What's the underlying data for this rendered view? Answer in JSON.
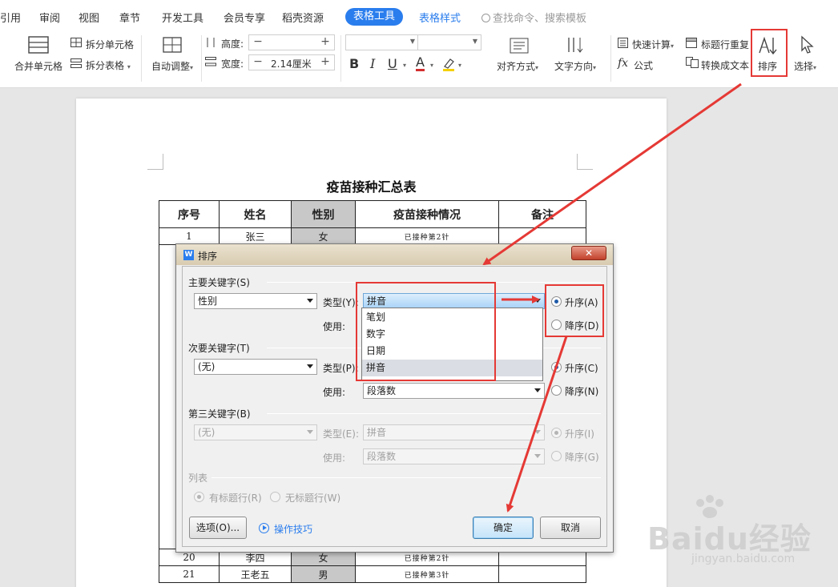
{
  "menubar": {
    "items": [
      "引用",
      "审阅",
      "视图",
      "章节",
      "开发工具",
      "会员专享",
      "稻壳资源"
    ],
    "active_tab": "表格工具",
    "style_tab": "表格样式",
    "search": "查找命令、搜索模板"
  },
  "ribbon": {
    "merge_cells": "合并单元格",
    "split_cells": "拆分单元格",
    "split_table": "拆分表格",
    "auto_adjust": "自动调整",
    "height_label": "高度:",
    "height_value": "",
    "width_label": "宽度:",
    "width_value": "2.14厘米",
    "font_name": "",
    "font_size": "",
    "bold": "B",
    "italic": "I",
    "underline": "U",
    "font_color": "A",
    "align": "对齐方式",
    "text_direction": "文字方向",
    "quick_calc": "快速计算",
    "header_repeat": "标题行重复",
    "formula": "公式",
    "convert_text": "转换成文本",
    "sort": "排序",
    "select": "选择"
  },
  "document": {
    "title": "疫苗接种汇总表",
    "headers": [
      "序号",
      "姓名",
      "性别",
      "疫苗接种情况",
      "备注"
    ],
    "rows": [
      {
        "no": "1",
        "name": "张三",
        "gender": "女",
        "status": "已接种第2针",
        "note": ""
      },
      {
        "no": "20",
        "name": "李四",
        "gender": "女",
        "status": "已接种第2针",
        "note": ""
      },
      {
        "no": "21",
        "name": "王老五",
        "gender": "男",
        "status": "已接种第3针",
        "note": ""
      }
    ]
  },
  "dialog": {
    "title": "排序",
    "close": "✕",
    "primary_key_label": "主要关键字(S)",
    "primary_key_value": "性别",
    "type_y_label": "类型(Y):",
    "type_y_value": "拼音",
    "use_label_1": "使用:",
    "asc_a": "升序(A)",
    "desc_d": "降序(D)",
    "type_options": [
      "笔划",
      "数字",
      "日期",
      "拼音"
    ],
    "secondary_key_label": "次要关键字(T)",
    "secondary_key_value": "(无)",
    "type_p_label": "类型(P):",
    "use_label_2": "使用:",
    "use_value_2": "段落数",
    "asc_c": "升序(C)",
    "desc_n": "降序(N)",
    "third_key_label": "第三关键字(B)",
    "third_key_value": "(无)",
    "type_e_label": "类型(E):",
    "type_e_value": "拼音",
    "use_label_3": "使用:",
    "use_value_3": "段落数",
    "asc_i": "升序(I)",
    "desc_g": "降序(G)",
    "list_label": "列表",
    "has_header": "有标题行(R)",
    "no_header": "无标题行(W)",
    "options_button": "选项(O)...",
    "tips_link": "操作技巧",
    "ok_button": "确定",
    "cancel_button": "取消"
  },
  "watermark": {
    "text": "Baidu经验",
    "url": "jingyan.baidu.com"
  },
  "colors": {
    "accent": "#2a7ded",
    "annotation": "#e53935"
  }
}
